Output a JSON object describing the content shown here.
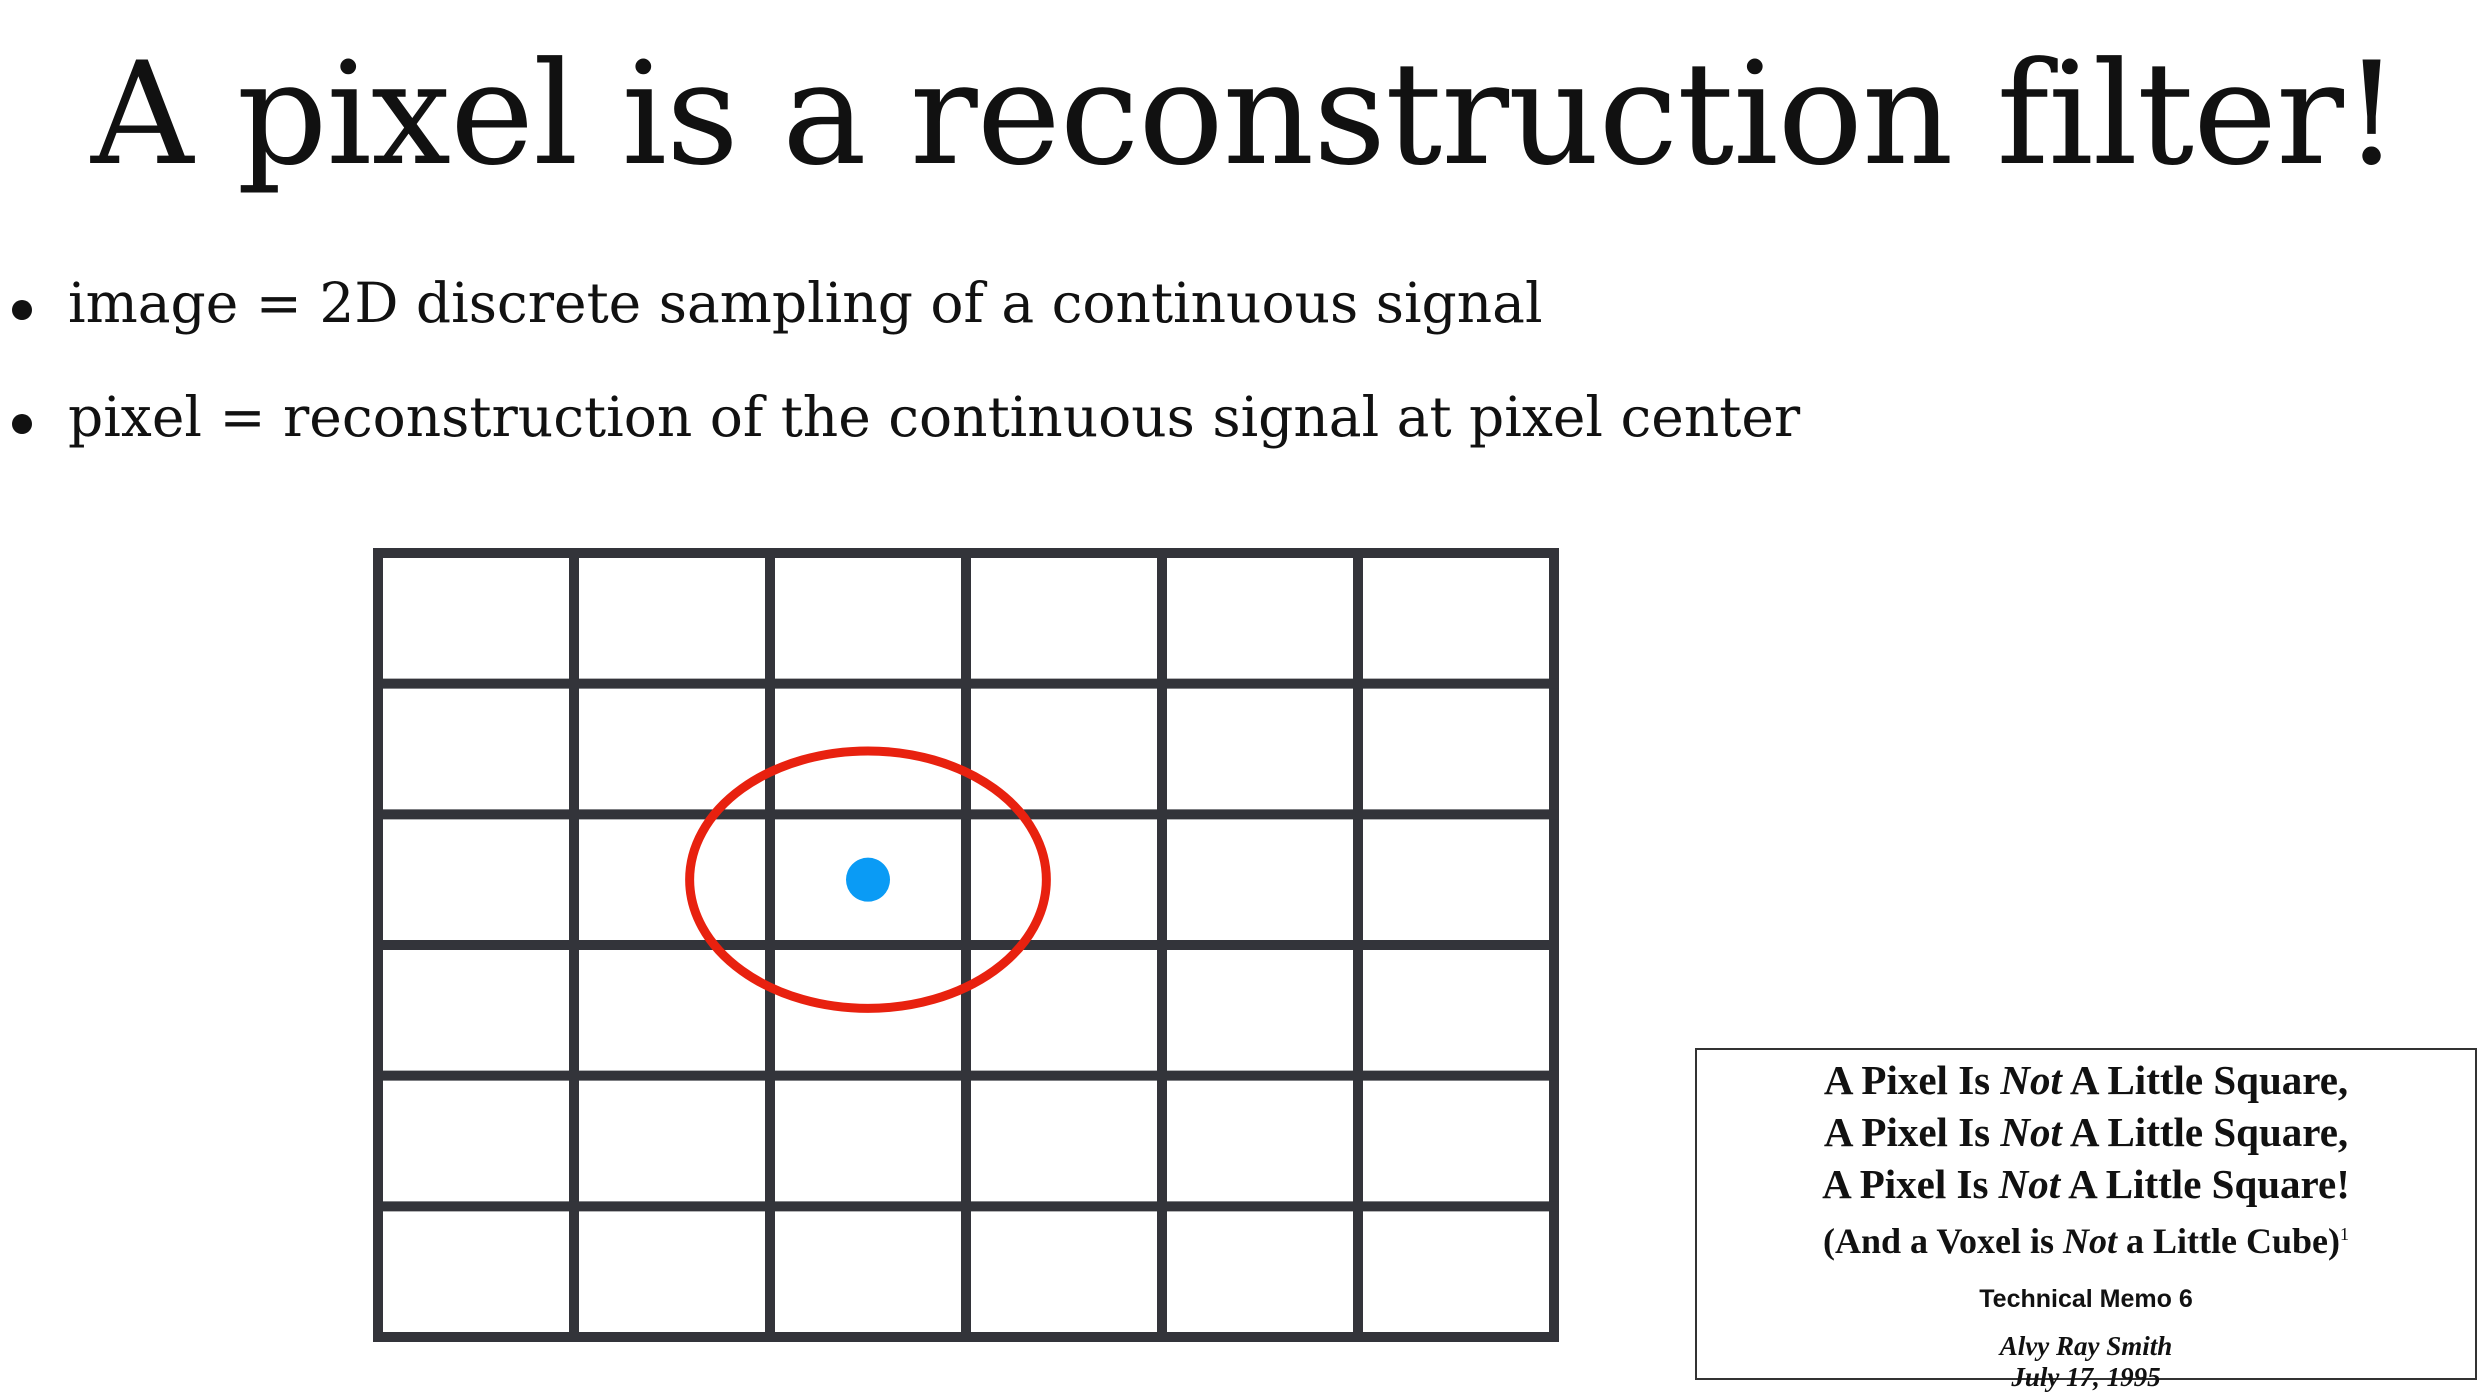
{
  "slide": {
    "title": "A pixel is a reconstruction filter!",
    "bullets": [
      {
        "text": "image = 2D discrete sampling of a continuous signal"
      },
      {
        "text": "pixel = reconstruction of the continuous signal at pixel center"
      }
    ]
  },
  "figure": {
    "grid_columns": 6,
    "grid_rows": 6,
    "highlighted_pixel": {
      "column": 3,
      "row": 3
    },
    "colors": {
      "grid_line": "#33343a",
      "filter_ellipse": "#e8210f",
      "sample_point": "#0a9bf5"
    }
  },
  "memo": {
    "line1_a": "A Pixel Is ",
    "line1_b": "Not",
    "line1_c": " A Little Square,",
    "line2_a": "A Pixel Is ",
    "line2_b": "Not",
    "line2_c": " A Little Square,",
    "line3_a": "A Pixel Is ",
    "line3_b": "Not",
    "line3_c": " A Little Square!",
    "subtitle_a": "(And a Voxel is ",
    "subtitle_b": "Not",
    "subtitle_c": " a Little Cube)",
    "footnote_mark": "1",
    "memo_label": "Technical Memo 6",
    "author": "Alvy Ray Smith",
    "date": "July 17, 1995"
  }
}
